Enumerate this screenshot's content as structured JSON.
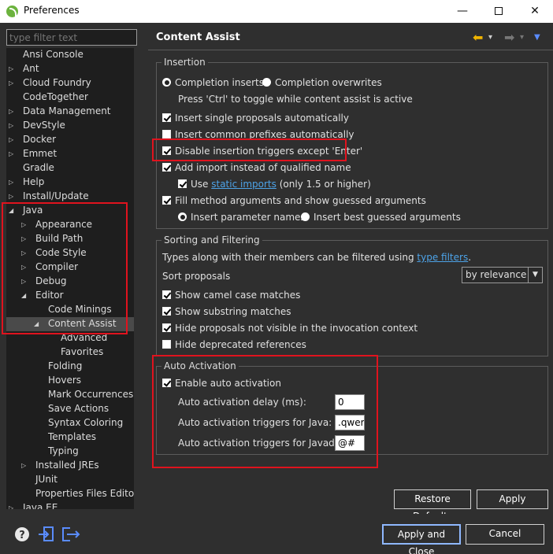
{
  "window": {
    "title": "Preferences",
    "minimize": "—",
    "close": "✕"
  },
  "filter": {
    "placeholder": "type filter text"
  },
  "tree": [
    {
      "label": "Ansi Console",
      "arrow": ""
    },
    {
      "label": "Ant",
      "arrow": "▷"
    },
    {
      "label": "Cloud Foundry",
      "arrow": "▷"
    },
    {
      "label": "CodeTogether",
      "arrow": ""
    },
    {
      "label": "Data Management",
      "arrow": "▷"
    },
    {
      "label": "DevStyle",
      "arrow": "▷"
    },
    {
      "label": "Docker",
      "arrow": "▷"
    },
    {
      "label": "Emmet",
      "arrow": "▷"
    },
    {
      "label": "Gradle",
      "arrow": ""
    },
    {
      "label": "Help",
      "arrow": "▷"
    },
    {
      "label": "Install/Update",
      "arrow": "▷"
    },
    {
      "label": "Java",
      "arrow": "◢"
    },
    {
      "label": "Appearance",
      "arrow": "▷"
    },
    {
      "label": "Build Path",
      "arrow": "▷"
    },
    {
      "label": "Code Style",
      "arrow": "▷"
    },
    {
      "label": "Compiler",
      "arrow": "▷"
    },
    {
      "label": "Debug",
      "arrow": "▷"
    },
    {
      "label": "Editor",
      "arrow": "◢"
    },
    {
      "label": "Code Minings",
      "arrow": ""
    },
    {
      "label": "Content Assist",
      "arrow": "◢"
    },
    {
      "label": "Advanced",
      "arrow": ""
    },
    {
      "label": "Favorites",
      "arrow": ""
    },
    {
      "label": "Folding",
      "arrow": ""
    },
    {
      "label": "Hovers",
      "arrow": ""
    },
    {
      "label": "Mark Occurrences",
      "arrow": ""
    },
    {
      "label": "Save Actions",
      "arrow": ""
    },
    {
      "label": "Syntax Coloring",
      "arrow": ""
    },
    {
      "label": "Templates",
      "arrow": ""
    },
    {
      "label": "Typing",
      "arrow": ""
    },
    {
      "label": "Installed JREs",
      "arrow": "▷"
    },
    {
      "label": "JUnit",
      "arrow": ""
    },
    {
      "label": "Properties Files Editor",
      "arrow": ""
    },
    {
      "label": "Java EE",
      "arrow": "▷"
    }
  ],
  "page": {
    "title": "Content Assist",
    "nav_back": "⬅",
    "nav_forward": "➡",
    "nav_dropdown": "▾",
    "menu": "▼"
  },
  "insertion": {
    "legend": "Insertion",
    "completion_inserts": "Completion inserts",
    "completion_overwrites": "Completion overwrites",
    "toggle_hint": "Press 'Ctrl' to toggle while content assist is active",
    "insert_single": "Insert single proposals automatically",
    "insert_common": "Insert common prefixes automatically",
    "disable_triggers": "Disable insertion triggers except 'Enter'",
    "add_import": "Add import instead of qualified name",
    "use": "Use",
    "static_imports": "static imports",
    "static_suffix": "(only 1.5 or higher)",
    "fill_args": "Fill method arguments and show guessed arguments",
    "insert_param_names": "Insert parameter names",
    "insert_best_guessed": "Insert best guessed arguments"
  },
  "sorting": {
    "legend": "Sorting and Filtering",
    "desc_prefix": "Types along with their members can be filtered using",
    "type_filters": "type filters",
    "desc_suffix": ".",
    "sort_label": "Sort proposals",
    "sort_value": "by relevance",
    "camel_case": "Show camel case matches",
    "substring": "Show substring matches",
    "hide_not_visible": "Hide proposals not visible in the invocation context",
    "hide_deprecated": "Hide deprecated references"
  },
  "auto": {
    "legend": "Auto Activation",
    "enable": "Enable auto activation",
    "delay_label": "Auto activation delay (ms):",
    "delay_value": "0",
    "java_label": "Auto activation triggers for Java:",
    "java_value": ".qwert",
    "javadoc_label": "Auto activation triggers for Javadoc:",
    "javadoc_value": "@#"
  },
  "buttons": {
    "restore_defaults": "Restore Defaults",
    "apply": "Apply",
    "apply_close": "Apply and Close",
    "cancel": "Cancel"
  },
  "colors": {
    "highlight": "#e0131e",
    "link": "#4da3e8",
    "nav_back": "#f0b400"
  }
}
